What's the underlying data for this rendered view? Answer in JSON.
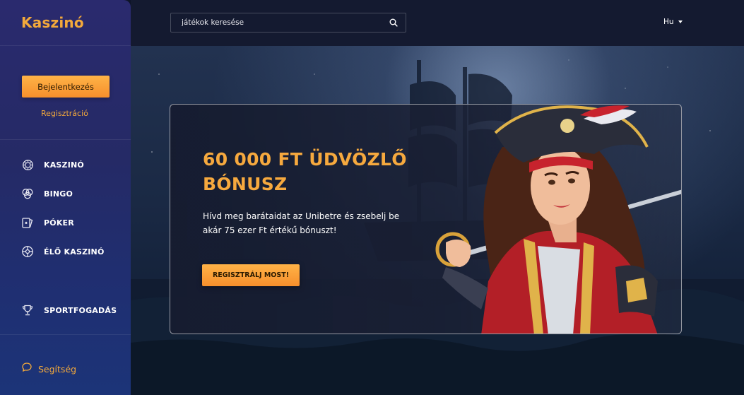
{
  "brand": {
    "logo": "Kaszinó"
  },
  "auth": {
    "login_label": "Bejelentkezés",
    "register_label": "Regisztráció"
  },
  "nav": {
    "items": [
      {
        "label": "KASZINÓ",
        "icon": "casino-chip-icon"
      },
      {
        "label": "BINGO",
        "icon": "bingo-balls-icon"
      },
      {
        "label": "PÓKER",
        "icon": "poker-cards-icon"
      },
      {
        "label": "ÉLŐ KASZINÓ",
        "icon": "live-casino-icon"
      },
      {
        "label": "SPORTFOGADÁS",
        "icon": "trophy-icon"
      }
    ]
  },
  "help": {
    "label": "Segítség",
    "icon": "chat-bubble-icon"
  },
  "search": {
    "placeholder": "játékok keresése",
    "icon": "search-icon"
  },
  "language": {
    "selected": "Hu"
  },
  "promo": {
    "title": "60 000 FT ÜDVÖZLŐ BÓNUSZ",
    "description": "Hívd meg barátaidat az Unibetre és zsebelj be akár 75 ezer Ft értékű bónuszt!",
    "cta_label": "REGISZTRÁLJ MOST!"
  },
  "colors": {
    "accent": "#f6a93e",
    "sidebar": "#27296a",
    "topbar": "#141a30"
  }
}
